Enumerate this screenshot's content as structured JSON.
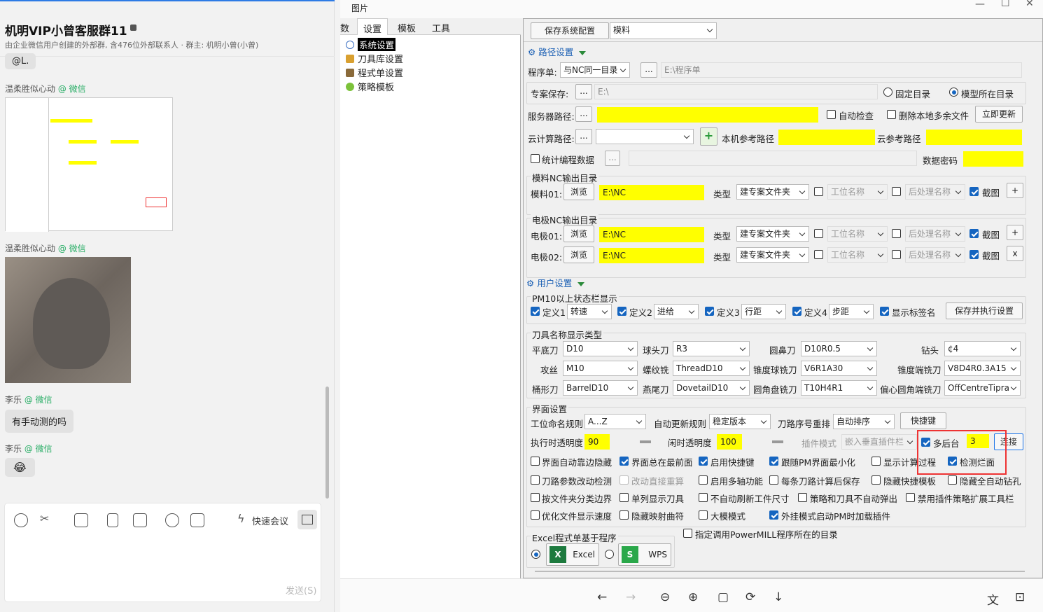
{
  "chat": {
    "title": "机明VIP小曾客服群11",
    "subtitle": "由企业微信用户创建的外部群, 含476位外部联系人 · 群主: 机明小曾(小曾)",
    "msg0": "@L.",
    "sender1": "温柔胜似心动",
    "source1": "@ 微信",
    "sender2": "温柔胜似心动",
    "source2": "@ 微信",
    "sender3": "李乐",
    "source3": "@ 微信",
    "msg3": "有手动测的吗",
    "sender4": "李乐",
    "source4": "@ 微信",
    "msg4": "😂",
    "quick_meeting": "快速会议",
    "send": "发送(S)"
  },
  "viewer": {
    "title": "图片"
  },
  "tree": {
    "tabs": [
      "数",
      "设置",
      "模板",
      "工具"
    ],
    "nodes": [
      "系统设置",
      "刀具库设置",
      "程式单设置",
      "策略模板"
    ]
  },
  "panel": {
    "save_btn": "保存系统配置",
    "mode": "模料",
    "path_section": "路径设置",
    "prog_label": "程序单:",
    "prog_combo": "与NC同一目录",
    "prog_path": "E:\\程序单",
    "case_label": "专案保存:",
    "case_path": "E:\\",
    "radio_fixed": "固定目录",
    "radio_model": "模型所在目录",
    "server_label": "服务器路径:",
    "auto_check": "自动检查",
    "del_extra": "删除本地多余文件",
    "update_now": "立即更新",
    "cloud_label": "云计算路径:",
    "local_ref": "本机参考路径",
    "cloud_ref": "云参考路径",
    "stats": "统计编程数据",
    "db_pwd": "数据密码",
    "mold_group": "模料NC输出目录",
    "mold01": "模料01:",
    "elec_group": "电极NC输出目录",
    "elec01": "电极01:",
    "elec02": "电极02:",
    "browse": "浏览",
    "nc_path": "E:\\NC",
    "type": "类型",
    "type_val": "建专案文件夹",
    "station": "工位名称",
    "post": "后处理名称",
    "snapshot": "截图",
    "plus": "+",
    "x": "x",
    "user_section": "用户设置",
    "pm10_group": "PM10以上状态栏显示",
    "def1": "定义1",
    "def1_val": "转速",
    "def2": "定义2",
    "def2_val": "进给",
    "def3": "定义3",
    "def3_val": "行距",
    "def4": "定义4",
    "def4_val": "步距",
    "show_tag": "显示标签名",
    "save_exec": "保存并执行设置",
    "tool_group": "刀具名称显示类型",
    "t_flat": "平底刀",
    "v_flat": "D10",
    "t_ball": "球头刀",
    "v_ball": "R3",
    "t_bull": "圆鼻刀",
    "v_bull": "D10R0.5",
    "t_drill": "钻头",
    "v_drill": "¢4",
    "t_tap": "攻丝",
    "v_tap": "M10",
    "t_thread": "螺纹铣",
    "v_thread": "ThreadD10",
    "t_taperball": "锥度球铣刀",
    "v_taperball": "V6R1A30",
    "t_taperend": "锥度端铣刀",
    "v_taperend": "V8D4R0.3A15",
    "t_barrel": "桶形刀",
    "v_barrel": "BarrelD10",
    "t_dove": "燕尾刀",
    "v_dove": "DovetailD10",
    "t_disc": "圆角盘铣刀",
    "v_disc": "T10H4R1",
    "t_offset": "偏心圆角端铣刀",
    "v_offset": "OffCentreTipra",
    "ui_group": "界面设置",
    "station_rule": "工位命名规则",
    "station_rule_val": "A...Z",
    "update_rule": "自动更新规则",
    "update_rule_val": "稳定版本",
    "reorder": "刀路序号重排",
    "reorder_val": "自动排序",
    "shortcut": "快捷键",
    "exec_alpha": "执行时透明度",
    "exec_alpha_val": "90",
    "idle_alpha": "闲时透明度",
    "idle_alpha_val": "100",
    "plugin_mode": "插件模式",
    "plugin_val": "嵌入垂直插件栏",
    "multi_bg": "多后台",
    "multi_val": "3",
    "connect": "连接",
    "opts": [
      [
        "界面自动靠边隐藏",
        "界面总在最前面",
        "启用快捷键",
        "跟随PM界面最小化",
        "显示计算过程",
        "检测烂面"
      ],
      [
        "刀路参数改动检测",
        "改动直接重算",
        "启用多轴功能",
        "每条刀路计算后保存",
        "隐藏快捷模板",
        "隐藏全自动钻孔"
      ],
      [
        "按文件夹分类边界",
        "单列显示刀具",
        "不自动刷新工件尺寸",
        "策略和刀具不自动弹出",
        "禁用插件策略扩展工具栏"
      ],
      [
        "优化文件显示速度",
        "隐藏映射曲符",
        "大模模式",
        "外挂模式启动PM时加载插件"
      ]
    ],
    "excel_group": "Excel程式单基于程序",
    "excel": "Excel",
    "wps": "WPS",
    "spec_pm": "指定调用PowerMILL程序所在的目录"
  }
}
